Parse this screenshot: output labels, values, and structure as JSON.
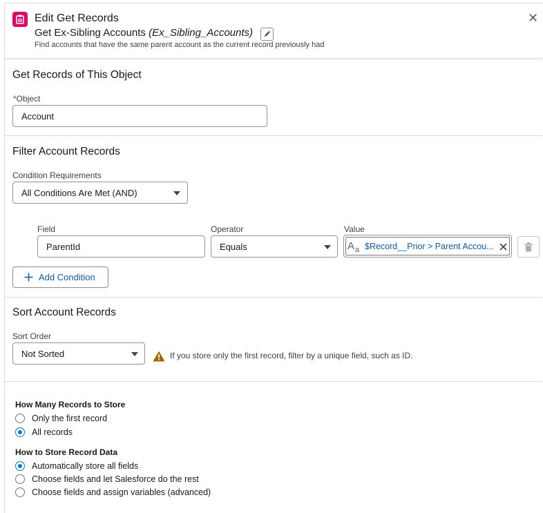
{
  "header": {
    "title": "Edit Get Records",
    "element_label": "Get Ex-Sibling Accounts",
    "api_name": "(Ex_Sibling_Accounts)",
    "description": "Find accounts that have the same parent account as the current record previously had"
  },
  "object_section": {
    "title": "Get Records of This Object",
    "object_label": "Object",
    "required_marker": "*",
    "object_value": "Account"
  },
  "filter_section": {
    "title": "Filter Account Records",
    "condition_label": "Condition Requirements",
    "condition_value": "All Conditions Are Met (AND)",
    "columns": {
      "field": "Field",
      "operator": "Operator",
      "value": "Value"
    },
    "row": {
      "field": "ParentId",
      "operator": "Equals",
      "value": "$Record__Prior > Parent Accou..."
    },
    "add_condition": "Add Condition"
  },
  "sort_section": {
    "title": "Sort Account Records",
    "sort_label": "Sort Order",
    "sort_value": "Not Sorted",
    "warning": "If you store only the first record, filter by a unique field, such as ID."
  },
  "store_section": {
    "how_many_label": "How Many Records to Store",
    "how_many_options": [
      {
        "label": "Only the first record",
        "selected": false
      },
      {
        "label": "All records",
        "selected": true
      }
    ],
    "how_store_label": "How to Store Record Data",
    "how_store_options": [
      {
        "label": "Automatically store all fields",
        "selected": true
      },
      {
        "label": "Choose fields and let Salesforce do the rest",
        "selected": false
      },
      {
        "label": "Choose fields and assign variables (advanced)",
        "selected": false
      }
    ]
  },
  "colors": {
    "brand_icon": "#e3066a",
    "link": "#0b5cab",
    "radio_selected": "#0176d3",
    "warning": "#a86403"
  }
}
